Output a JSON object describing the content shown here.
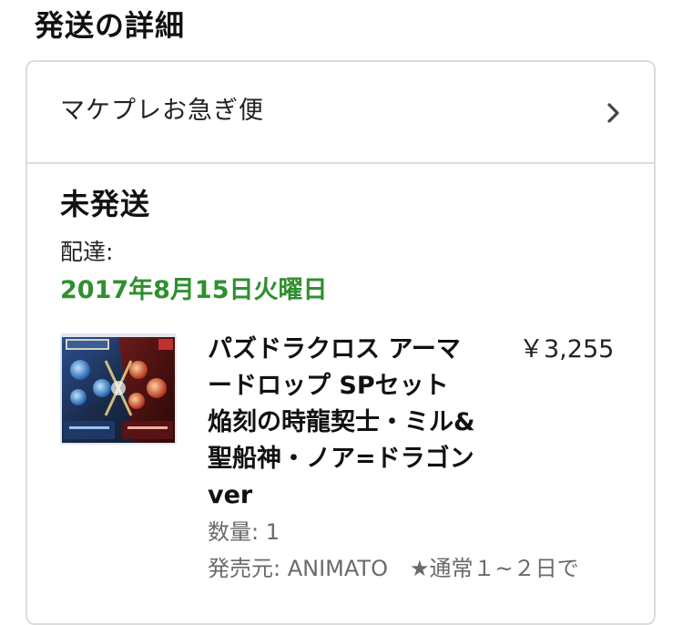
{
  "section_title": "発送の詳細",
  "shipping": {
    "method": "マケプレお急ぎ便",
    "chevron_icon": "chevron-right-icon"
  },
  "status": "未発送",
  "delivery": {
    "label": "配達:",
    "date": "2017年8月15日火曜日",
    "date_color": "#2f8f2f"
  },
  "product": {
    "title": "パズドラクロス アーマードロップ SPセット 焔刻の時龍契士・ミル&聖船神・ノア=ドラゴン ver",
    "price": "￥3,255",
    "quantity": "数量: 1",
    "seller": "発売元: ANIMATO　★通常１~２日で",
    "image_alt": "product-image"
  }
}
